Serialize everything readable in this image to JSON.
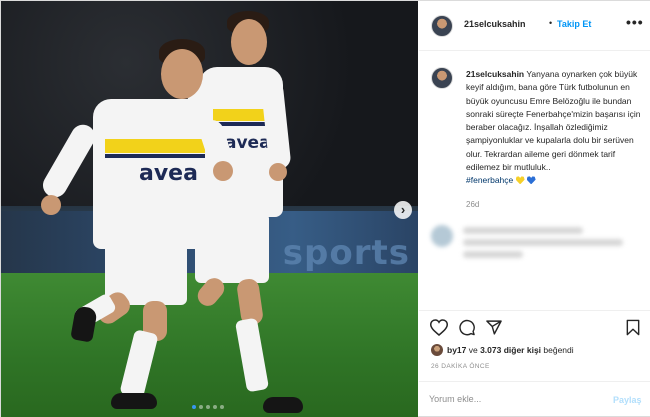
{
  "header": {
    "username": "21selcuksahin",
    "separator": "•",
    "follow_label": "Takip Et",
    "more_label": "•••"
  },
  "caption": {
    "username": "21selcuksahin",
    "text": "Yanyana oynarken çok büyük keyif aldığım, bana göre Türk futbolunun en büyük oyuncusu Emre Belözoğlu ile bundan sonraki süreçte Fenerbahçe'mizin başarısı için beraber olacağız. İnşallah özlediğimiz şampiyonluklar ve kupalarla dolu bir serüven olur. Tekrardan aileme geri dönmek tarif edilemez bir mutluluk..",
    "hashtag": "#fenerbahçe",
    "emojis": [
      "yellow-heart",
      "blue-heart"
    ],
    "time": "26d"
  },
  "photo": {
    "sponsor_text": "avea",
    "board_text": "sports",
    "next_label": "›",
    "carousel_total": 5,
    "carousel_active_index": 0
  },
  "icons": {
    "like": "heart-outline-icon",
    "comment": "comment-bubble-icon",
    "share": "paper-plane-icon",
    "save": "bookmark-icon"
  },
  "likes": {
    "user": "by17",
    "connector": " ve ",
    "count": "3.073 diğer kişi",
    "suffix": " beğendi"
  },
  "post_time": "26 DAKİKA ÖNCE",
  "comment_input": {
    "placeholder": "Yorum ekle...",
    "submit_label": "Paylaş"
  },
  "colors": {
    "link_blue": "#0095f6",
    "submit_disabled": "#b2dffc",
    "kit_yellow": "#f2d21a",
    "kit_navy": "#1d2a55"
  }
}
